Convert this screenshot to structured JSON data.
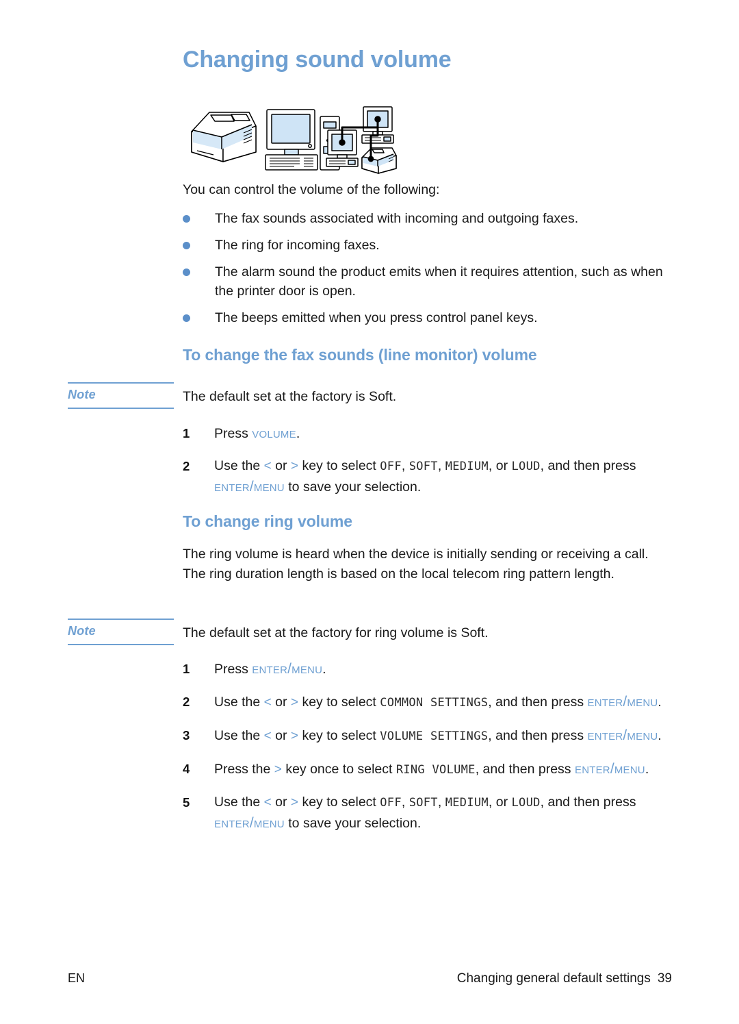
{
  "page": {
    "title": "Changing sound volume",
    "accent_color": "#6fa0d2",
    "bullet_color": "#5b8fc9",
    "text_color": "#1a1a1a"
  },
  "illustration": {
    "name": "printer-computer-network-illustration",
    "items": [
      "printer-icon",
      "desktop-computer-icon",
      "network-computers-printer-icon"
    ]
  },
  "intro": {
    "text": "You can control the volume of the following:"
  },
  "bullets": [
    {
      "text": "The fax sounds associated with incoming and outgoing faxes."
    },
    {
      "text": "The ring for incoming faxes."
    },
    {
      "text": "The alarm sound the product emits when it requires attention, such as when the printer door is open."
    },
    {
      "text": "The beeps emitted when you press control panel keys."
    }
  ],
  "section_fax": {
    "heading": "To change the fax sounds (line monitor) volume",
    "note": {
      "label": "Note",
      "text": "The default set at the factory is Soft."
    },
    "steps": [
      {
        "number": "1",
        "parts": [
          {
            "type": "plain",
            "text": "Press "
          },
          {
            "type": "key",
            "text": "Volume"
          },
          {
            "type": "plain",
            "text": "."
          }
        ]
      },
      {
        "number": "2",
        "parts": [
          {
            "type": "plain",
            "text": "Use the "
          },
          {
            "type": "arrow",
            "text": "<"
          },
          {
            "type": "plain",
            "text": " or "
          },
          {
            "type": "arrow",
            "text": ">"
          },
          {
            "type": "plain",
            "text": " key to select "
          },
          {
            "type": "mono",
            "text": "OFF"
          },
          {
            "type": "plain",
            "text": ", "
          },
          {
            "type": "mono",
            "text": "SOFT"
          },
          {
            "type": "plain",
            "text": ", "
          },
          {
            "type": "mono",
            "text": "MEDIUM"
          },
          {
            "type": "plain",
            "text": ", or "
          },
          {
            "type": "mono",
            "text": "LOUD"
          },
          {
            "type": "plain",
            "text": ",  and then press "
          },
          {
            "type": "key",
            "text": "Enter/Menu"
          },
          {
            "type": "plain",
            "text": " to save your selection."
          }
        ]
      }
    ]
  },
  "section_ring": {
    "heading": "To change ring volume",
    "paragraph": "The ring volume is heard when the device is initially sending or receiving a call. The ring duration length is based on the local telecom ring pattern length.",
    "note": {
      "label": "Note",
      "text": "The default set at the factory for ring volume is Soft."
    },
    "steps": [
      {
        "number": "1",
        "parts": [
          {
            "type": "plain",
            "text": "Press "
          },
          {
            "type": "key",
            "text": "Enter/Menu"
          },
          {
            "type": "plain",
            "text": "."
          }
        ]
      },
      {
        "number": "2",
        "parts": [
          {
            "type": "plain",
            "text": "Use the "
          },
          {
            "type": "arrow",
            "text": "<"
          },
          {
            "type": "plain",
            "text": " or "
          },
          {
            "type": "arrow",
            "text": ">"
          },
          {
            "type": "plain",
            "text": " key to select "
          },
          {
            "type": "mono",
            "text": "COMMON SETTINGS"
          },
          {
            "type": "plain",
            "text": ", and then press "
          },
          {
            "type": "key",
            "text": "Enter/Menu"
          },
          {
            "type": "plain",
            "text": "."
          }
        ]
      },
      {
        "number": "3",
        "parts": [
          {
            "type": "plain",
            "text": "Use the "
          },
          {
            "type": "arrow",
            "text": "<"
          },
          {
            "type": "plain",
            "text": " or "
          },
          {
            "type": "arrow",
            "text": ">"
          },
          {
            "type": "plain",
            "text": " key to select "
          },
          {
            "type": "mono",
            "text": "VOLUME SETTINGS"
          },
          {
            "type": "plain",
            "text": ", and then press "
          },
          {
            "type": "key",
            "text": "Enter/Menu"
          },
          {
            "type": "plain",
            "text": "."
          }
        ]
      },
      {
        "number": "4",
        "parts": [
          {
            "type": "plain",
            "text": "Press the "
          },
          {
            "type": "arrow",
            "text": ">"
          },
          {
            "type": "plain",
            "text": " key once to select "
          },
          {
            "type": "mono",
            "text": "RING VOLUME"
          },
          {
            "type": "plain",
            "text": ", and then press "
          },
          {
            "type": "key",
            "text": "Enter/Menu"
          },
          {
            "type": "plain",
            "text": "."
          }
        ]
      },
      {
        "number": "5",
        "parts": [
          {
            "type": "plain",
            "text": "Use the "
          },
          {
            "type": "arrow",
            "text": "<"
          },
          {
            "type": "plain",
            "text": " or "
          },
          {
            "type": "arrow",
            "text": ">"
          },
          {
            "type": "plain",
            "text": " key to select "
          },
          {
            "type": "mono",
            "text": "OFF"
          },
          {
            "type": "plain",
            "text": ", "
          },
          {
            "type": "mono",
            "text": "SOFT"
          },
          {
            "type": "plain",
            "text": ", "
          },
          {
            "type": "mono",
            "text": "MEDIUM"
          },
          {
            "type": "plain",
            "text": ", or "
          },
          {
            "type": "mono",
            "text": "LOUD"
          },
          {
            "type": "plain",
            "text": ", and then press "
          },
          {
            "type": "key",
            "text": "Enter/Menu"
          },
          {
            "type": "plain",
            "text": " to save your selection."
          }
        ]
      }
    ]
  },
  "footer": {
    "language": "EN",
    "running_head": "Changing general default settings",
    "page_number": "39"
  }
}
